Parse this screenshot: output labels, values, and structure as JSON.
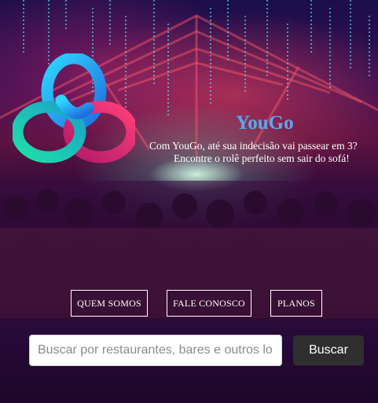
{
  "brand": {
    "title": "YouGo",
    "tagline": "Com YouGo, até sua indecisão vai passear em 3?",
    "subtagline": "Encontre o rolê perfeito sem sair do sofá!"
  },
  "nav": {
    "items": [
      {
        "label": "QUEM SOMOS"
      },
      {
        "label": "FALE CONOSCO"
      },
      {
        "label": "PLANOS"
      }
    ]
  },
  "search": {
    "placeholder": "Buscar por restaurantes, bares e outros lo",
    "button_label": "Buscar"
  },
  "colors": {
    "brand_title": "#5aa8f0",
    "search_button": "#2f2f2f",
    "footer_bg": "#1d0629"
  },
  "icons": {
    "logo": "trefoil-knot-logo"
  }
}
